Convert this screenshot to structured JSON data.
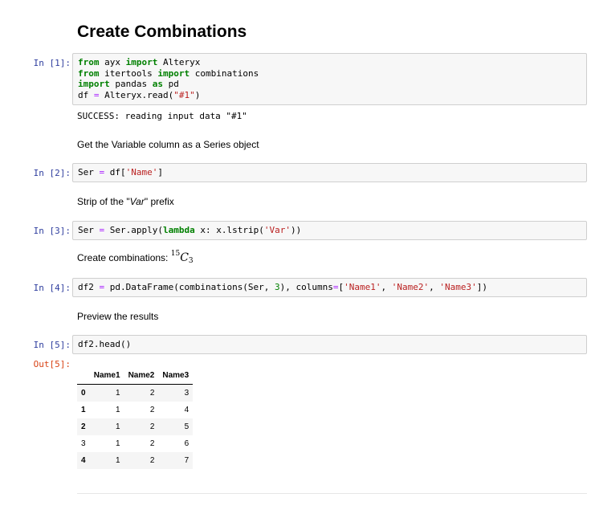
{
  "title": "Create Combinations",
  "cells": [
    {
      "prompt": "In [1]:",
      "lines": [
        [
          {
            "t": "from",
            "c": "kw"
          },
          {
            "t": " ayx "
          },
          {
            "t": "import",
            "c": "kw"
          },
          {
            "t": " Alteryx"
          }
        ],
        [
          {
            "t": "from",
            "c": "kw"
          },
          {
            "t": " itertools "
          },
          {
            "t": "import",
            "c": "kw"
          },
          {
            "t": " combinations"
          }
        ],
        [
          {
            "t": "import",
            "c": "kw"
          },
          {
            "t": " pandas "
          },
          {
            "t": "as",
            "c": "kw"
          },
          {
            "t": " pd"
          }
        ],
        [
          {
            "t": "df "
          },
          {
            "t": "=",
            "c": "op"
          },
          {
            "t": " Alteryx.read("
          },
          {
            "t": "\"#1\"",
            "c": "str"
          },
          {
            "t": ")"
          }
        ]
      ],
      "output": "SUCCESS: reading input data \"#1\""
    },
    {
      "prompt": "In [2]:",
      "lines": [
        [
          {
            "t": "Ser "
          },
          {
            "t": "=",
            "c": "op"
          },
          {
            "t": " df["
          },
          {
            "t": "'Name'",
            "c": "str"
          },
          {
            "t": "]"
          }
        ]
      ]
    },
    {
      "prompt": "In [3]:",
      "lines": [
        [
          {
            "t": "Ser "
          },
          {
            "t": "=",
            "c": "op"
          },
          {
            "t": " Ser.apply("
          },
          {
            "t": "lambda",
            "c": "kw"
          },
          {
            "t": " x: x.lstrip("
          },
          {
            "t": "'Var'",
            "c": "str"
          },
          {
            "t": "))"
          }
        ]
      ]
    },
    {
      "prompt": "In [4]:",
      "lines": [
        [
          {
            "t": "df2 "
          },
          {
            "t": "=",
            "c": "op"
          },
          {
            "t": " pd.DataFrame(combinations(Ser, "
          },
          {
            "t": "3",
            "c": "num"
          },
          {
            "t": "), columns"
          },
          {
            "t": "=",
            "c": "op"
          },
          {
            "t": "["
          },
          {
            "t": "'Name1'",
            "c": "str"
          },
          {
            "t": ", "
          },
          {
            "t": "'Name2'",
            "c": "str"
          },
          {
            "t": ", "
          },
          {
            "t": "'Name3'",
            "c": "str"
          },
          {
            "t": "])"
          }
        ]
      ]
    },
    {
      "prompt": "In [5]:",
      "lines": [
        [
          {
            "t": "df2.head()"
          }
        ]
      ]
    }
  ],
  "markdown": {
    "get_variable": "Get the Variable column as a Series object",
    "strip_prefix_before": "Strip of the \"",
    "strip_prefix_italic": "Var",
    "strip_prefix_after": "\" prefix",
    "create_combinations": "Create combinations: ",
    "combo_sup": "15",
    "combo_letter": "C",
    "combo_sub": "3",
    "preview": "Preview the results"
  },
  "out_prompt": "Out[5]:",
  "dataframe": {
    "columns": [
      "",
      "Name1",
      "Name2",
      "Name3"
    ],
    "rows": [
      {
        "index": "0",
        "values": [
          "1",
          "2",
          "3"
        ]
      },
      {
        "index": "1",
        "values": [
          "1",
          "2",
          "4"
        ]
      },
      {
        "index": "2",
        "values": [
          "1",
          "2",
          "5"
        ]
      },
      {
        "index": "3",
        "values": [
          "1",
          "2",
          "6"
        ]
      },
      {
        "index": "4",
        "values": [
          "1",
          "2",
          "7"
        ]
      }
    ]
  }
}
